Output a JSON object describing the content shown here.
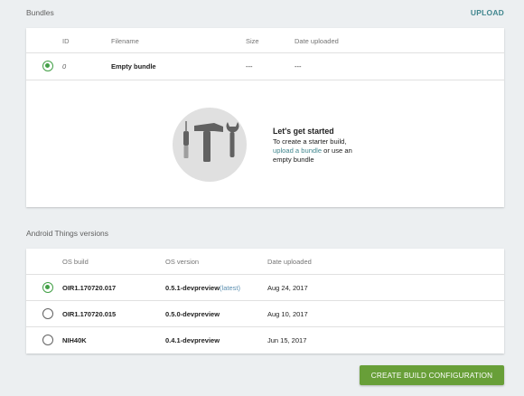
{
  "bundles": {
    "title": "Bundles",
    "upload_label": "UPLOAD",
    "columns": [
      "ID",
      "Filename",
      "Size",
      "Date uploaded"
    ],
    "rows": [
      {
        "selected": true,
        "id": "0",
        "filename": "Empty bundle",
        "size": "---",
        "date": "---"
      }
    ],
    "empty_state": {
      "title": "Let's get started",
      "line1": "To create a starter build,",
      "link": "upload a bundle",
      "line2_rest": " or use an",
      "line3": "empty bundle",
      "illustration": "tools-icon"
    }
  },
  "versions": {
    "title": "Android Things versions",
    "columns": [
      "OS build",
      "OS version",
      "Date uploaded"
    ],
    "rows": [
      {
        "selected": true,
        "build": "OIR1.170720.017",
        "version": "0.5.1-devpreview",
        "tag": "(latest)",
        "date": "Aug 24, 2017"
      },
      {
        "selected": false,
        "build": "OIR1.170720.015",
        "version": "0.5.0-devpreview",
        "tag": "",
        "date": "Aug 10, 2017"
      },
      {
        "selected": false,
        "build": "NIH40K",
        "version": "0.4.1-devpreview",
        "tag": "",
        "date": "Jun 15, 2017"
      }
    ]
  },
  "actions": {
    "create_label": "CREATE BUILD CONFIGURATION"
  },
  "colors": {
    "accent_green": "#43a047",
    "button_green": "#689f38",
    "link_teal": "#42878f"
  }
}
